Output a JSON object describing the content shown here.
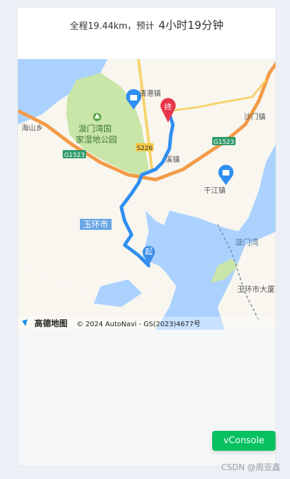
{
  "route": {
    "distance_text": "全程19.44km，预计",
    "duration_text": "4小时19分钟"
  },
  "map": {
    "labels": {
      "qinggang": "清港镇",
      "shamen": "沙门镇",
      "haishan": "海山乡",
      "wetland_line1": "漩门湾国",
      "wetland_line2": "家湿地公园",
      "kanmen_partial": "溪镇",
      "ganjiang": "干江镇",
      "yuhuan_city": "玉环市",
      "xuanmenwan": "漩门湾",
      "yuhuan_bridge": "玉环市大厦"
    },
    "road_badges": {
      "g1523_left": "G1523",
      "g1523_right": "G1523",
      "s226": "S226"
    },
    "markers": {
      "start": "起",
      "end": "终"
    },
    "attribution": {
      "logo_text": "高德地图",
      "copyright": "© 2024 AutoNavi - GS(2023)4677号"
    }
  },
  "vconsole": {
    "label": "vConsole"
  },
  "watermark": {
    "text": "CSDN @周亚鑫"
  },
  "colors": {
    "route": "#2f8ff0",
    "water": "#abd2ff",
    "land": "#f8f6ef",
    "park": "#c9e5a8",
    "highway": "#f39a47",
    "vconsole": "#07c160"
  }
}
